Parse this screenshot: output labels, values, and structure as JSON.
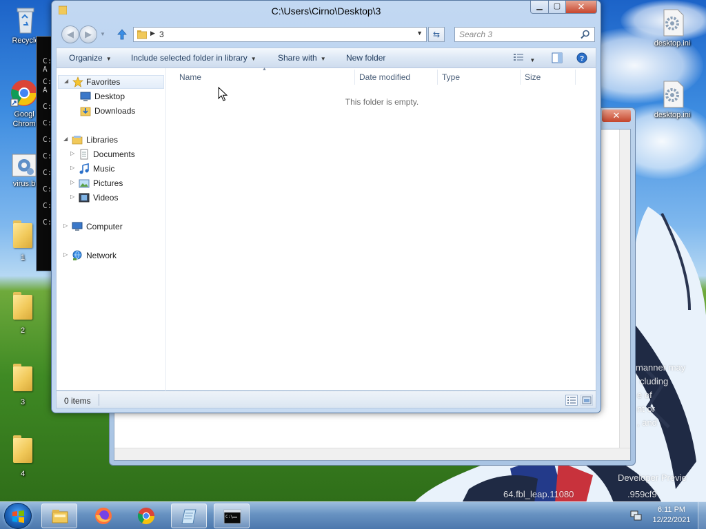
{
  "desktop": {
    "icons_left": [
      {
        "label": "Recycle",
        "icon": "recycle-bin-icon"
      },
      {
        "label": "Googl Chrom",
        "icon": "chrome-icon"
      },
      {
        "label": "virus.b",
        "icon": "batch-file-icon"
      },
      {
        "label": "1",
        "icon": "folder-icon"
      },
      {
        "label": "2",
        "icon": "folder-icon"
      },
      {
        "label": "3",
        "icon": "folder-icon"
      },
      {
        "label": "4",
        "icon": "folder-icon"
      }
    ],
    "icons_right": [
      {
        "label": "desktop.ini",
        "icon": "settings-file-icon"
      },
      {
        "label": "desktop.ini",
        "icon": "settings-file-icon"
      }
    ],
    "watermark_lines": [
      "manner may",
      "cluding",
      "e of",
      "nt or",
      ", and"
    ],
    "build_lines": [
      "Developer Previe",
      "64.fbl_leap.11080",
      ".959cf9"
    ],
    "cmd_lines": [
      "C:",
      "A",
      "C:",
      "A",
      "C:",
      "C:",
      "C:",
      "C:",
      "C:",
      "C:",
      "C:",
      "C:"
    ]
  },
  "explorer": {
    "title": "C:\\Users\\Cirno\\Desktop\\3",
    "address_text": "3",
    "search_placeholder": "Search 3",
    "toolbar": {
      "organize": "Organize",
      "include_library": "Include selected folder in library",
      "share_with": "Share with",
      "new_folder": "New folder"
    },
    "nav": {
      "favorites": "Favorites",
      "desktop": "Desktop",
      "downloads": "Downloads",
      "libraries": "Libraries",
      "documents": "Documents",
      "music": "Music",
      "pictures": "Pictures",
      "videos": "Videos",
      "computer": "Computer",
      "network": "Network"
    },
    "columns": {
      "name": "Name",
      "date_modified": "Date modified",
      "type": "Type",
      "size": "Size"
    },
    "empty_message": "This folder is empty.",
    "status": "0 items"
  },
  "taskbar": {
    "apps": [
      "file-explorer-icon",
      "firefox-icon",
      "chrome-icon",
      "notepad-icon",
      "command-prompt-icon"
    ],
    "clock_time": "6:11 PM",
    "clock_date": "12/22/2021"
  },
  "colors": {
    "close_red": "#c7452d",
    "toolbar_text": "#1e395b",
    "column_header_text": "#4c607a"
  }
}
